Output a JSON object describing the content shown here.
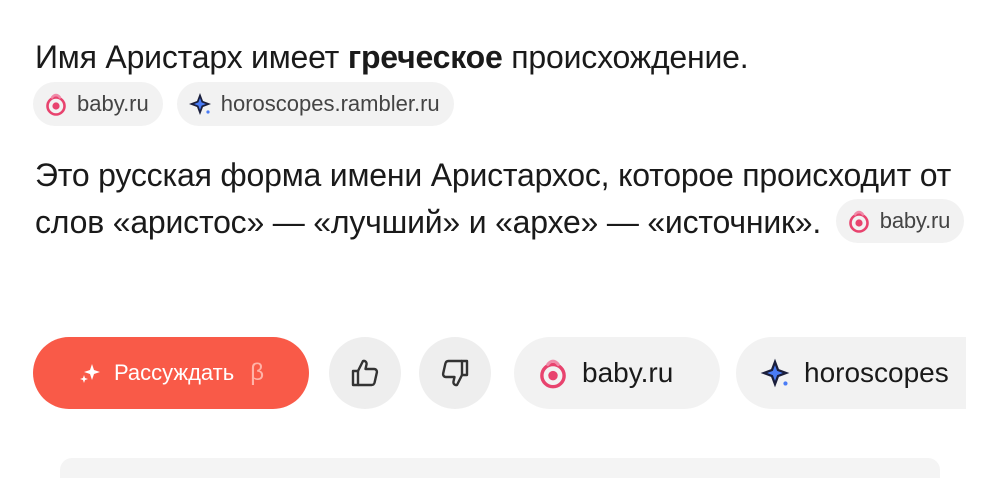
{
  "answer": {
    "line1": {
      "before": "Имя Аристарх имеет ",
      "bold": "греческое",
      "after": " происхождение."
    },
    "sources1": [
      {
        "label": "baby.ru",
        "icon": "baby-ru-logo-icon"
      },
      {
        "label": "horoscopes.rambler.ru",
        "icon": "rambler-sparkle-icon"
      }
    ],
    "paragraph2": "Это русская форма имени Аристархос, которое происходит от слов «аристос» — «лучший» и «архе» — «источник».",
    "source2": {
      "label": "baby.ru",
      "icon": "baby-ru-logo-icon"
    }
  },
  "actions": {
    "reason_label": "Рассуждать",
    "beta": "β",
    "like_icon": "thumbs-up-icon",
    "dislike_icon": "thumbs-down-icon",
    "chip_baby": "baby.ru",
    "chip_horoscopes": "horoscopes"
  },
  "colors": {
    "accent": "#f95a48",
    "chip_bg": "#f2f2f2",
    "baby_pink": "#e8436e",
    "rambler_dark": "#1b1f3b",
    "rambler_blue": "#4a7cf6"
  }
}
